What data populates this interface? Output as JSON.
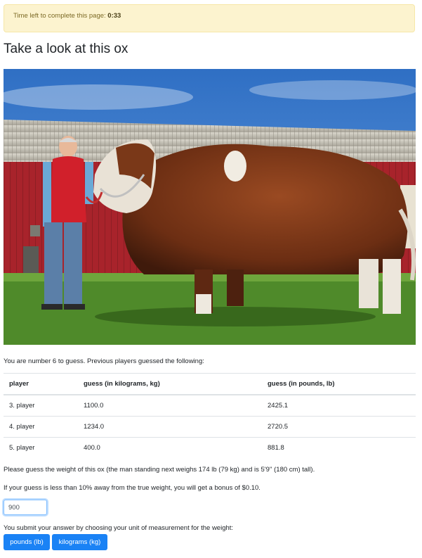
{
  "timer": {
    "label": "Time left to complete this page:",
    "value": "0:33"
  },
  "page": {
    "title": "Take a look at this ox"
  },
  "intro": "You are number 6 to guess. Previous players guessed the following:",
  "table": {
    "headers": [
      "player",
      "guess (in kilograms, kg)",
      "guess (in pounds, lb)"
    ],
    "rows": [
      [
        "3. player",
        "1100.0",
        "2425.1"
      ],
      [
        "4. player",
        "1234.0",
        "2720.5"
      ],
      [
        "5. player",
        "400.0",
        "881.8"
      ]
    ]
  },
  "instructions": {
    "guess_prompt": "Please guess the weight of this ox (the man standing next weighs 174 lb (79 kg) and is 5'9'' (180 cm) tall).",
    "bonus": "If your guess is less than 10% away from the true weight, you will get a bonus of $0.10.",
    "submit_prompt": "You submit your answer by choosing your unit of measurement for the weight:"
  },
  "guess_input": {
    "value": "900",
    "placeholder": ""
  },
  "buttons": {
    "pounds": "pounds (lb)",
    "kilograms": "kilograms (kg)"
  },
  "colors": {
    "timer_bg": "#fcf3cf",
    "primary_button": "#1a82f5",
    "input_focus": "#80bdff"
  }
}
